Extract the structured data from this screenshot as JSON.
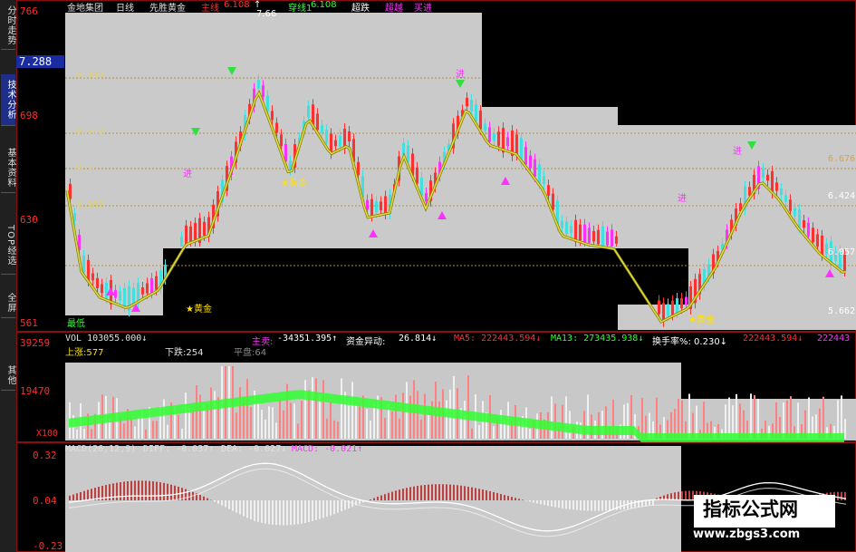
{
  "sidebar": {
    "tabs": [
      {
        "label": "分时走势",
        "active": false
      },
      {
        "label": "技术分析",
        "active": true
      },
      {
        "label": "基本资料",
        "active": false
      },
      {
        "label": "TOP经选",
        "active": false
      },
      {
        "label": "全屏",
        "active": false
      },
      {
        "label": "其他",
        "active": false
      }
    ]
  },
  "header": {
    "stock": "金地集团",
    "period": "日线",
    "indicator": "先胜黄金",
    "main_label": "主线",
    "main_value": "6.108",
    "arrow_up": "↑",
    "cross_label": "穿线1",
    "cross_value": "6.108",
    "super_label": "超跌",
    "warn_label": "超越",
    "buy_label": "买进"
  },
  "price_axis": {
    "top": "766",
    "current": "7.288",
    "mid1": "698",
    "mid2": "630",
    "low": "561",
    "peak_label": "7.66",
    "low_label": "最低"
  },
  "fib_levels": [
    "0.809",
    "0.618",
    "0.5",
    "0.382"
  ],
  "right_labels": {
    "r1": "6.676",
    "r2": "6.424",
    "r3": "6.057",
    "r4": "5.662"
  },
  "annotations": {
    "gold1": "★黄金",
    "gold2": "★黄金",
    "gold3": "★黄金",
    "buy_marker": "进"
  },
  "volume": {
    "line1": "VOL 103055.000↓",
    "main_sell_label": "主卖:",
    "main_sell_value": "-34351.395↑",
    "fund_label": "资金异动:",
    "fund_value": "26.814↓",
    "ma5": "MA5: 222443.594↓",
    "ma13": "MA13: 273435.938↓",
    "turnover": "换手率%: 0.230↓",
    "extra1": "222443.594↓",
    "extra2": "222443",
    "up_count": "上涨:577",
    "down_count": "下跌:254",
    "flat_count": "平盘:64",
    "axis_top": "39259",
    "axis_mid": "19470",
    "axis_unit": "X100"
  },
  "macd": {
    "params": "MACD(26,12,9)",
    "diff": "DIFF: -0.037↑",
    "dea": "DEA: -0.027↓",
    "macd_val": "MACD: -0.021↑",
    "axis_top": "0.32",
    "axis_mid": "0.04",
    "axis_low": "-0.23"
  },
  "watermark": {
    "title": "指标公式网",
    "url": "www.zbgs3.com"
  },
  "colors": {
    "up": "#ff3030",
    "down": "#40e0e0",
    "magenta": "#ff30ff",
    "ma_line": "#c8c800",
    "volume_green": "#30ff30",
    "accent_panel": "#c8c8c8"
  }
}
